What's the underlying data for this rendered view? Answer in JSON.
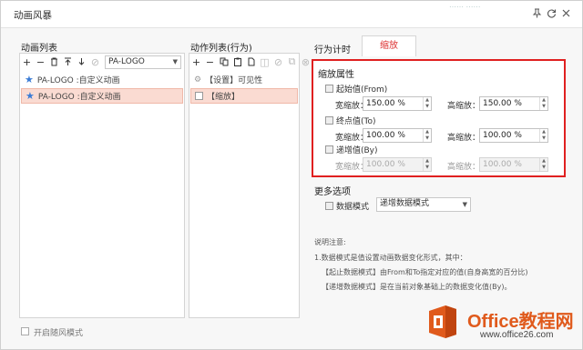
{
  "window": {
    "title": "动画风暴",
    "top_blur": "…… ……"
  },
  "left_panel": {
    "label": "动画列表",
    "combo_value": "PA-LOGO",
    "items": [
      {
        "label": "PA-LOGO :自定义动画",
        "selected": false
      },
      {
        "label": "PA-LOGO :自定义动画",
        "selected": true
      }
    ]
  },
  "mid_panel": {
    "label": "动作列表(行为)",
    "items": [
      {
        "label": "【设置】可见性",
        "selected": false
      },
      {
        "label": "【缩放】",
        "selected": true
      }
    ]
  },
  "right_panel": {
    "tab_static": "行为计时",
    "tab_active": "缩放",
    "scale_group": {
      "title": "缩放属性",
      "from": {
        "label": "起始值(From)",
        "width_label": "宽缩放：",
        "width_value": "150.00 %",
        "height_label": "高缩放：",
        "height_value": "150.00 %"
      },
      "to": {
        "label": "终点值(To)",
        "width_label": "宽缩放：",
        "width_value": "100.00 %",
        "height_label": "高缩放：",
        "height_value": "100.00 %"
      },
      "by": {
        "label": "递增值(By)",
        "width_label": "宽缩放：",
        "width_value": "100.00 %",
        "height_label": "高缩放：",
        "height_value": "100.00 %"
      }
    },
    "more_options": {
      "title": "更多选项",
      "data_mode_label": "数据模式",
      "data_mode_value": "递增数据模式"
    },
    "notes": {
      "title": "说明注意:",
      "line1": "1.数据模式是值设置动画数据变化形式，其中：",
      "line2": "【起止数据模式】由From和To指定对应的值(自身高宽的百分比)",
      "line3": "【递增数据模式】是在当前对象基础上的数据变化值(By)。"
    }
  },
  "footer": {
    "checkbox_label": "开启随风模式"
  },
  "watermark": {
    "title": "Office教程网",
    "subtitle": "www.office26.com"
  },
  "colors": {
    "accent_red": "#e02020",
    "selection": "#fadbd2",
    "star_blue": "#3a7bd5",
    "watermark_orange": "#e05a1c"
  }
}
